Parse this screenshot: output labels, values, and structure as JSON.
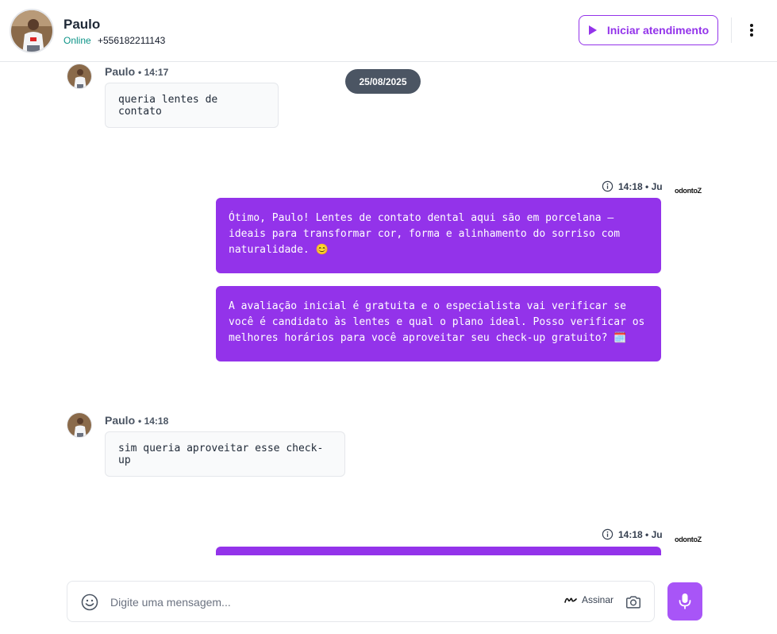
{
  "header": {
    "contact_name": "Paulo",
    "status": "Online",
    "phone": "+556182211143",
    "start_button_label": "Iniciar atendimento"
  },
  "chat": {
    "date_separator": "25/08/2025",
    "messages": [
      {
        "direction": "in",
        "sender": "Paulo",
        "time": "14:17",
        "text": "queria lentes de contato"
      },
      {
        "direction": "out",
        "sender": "Ju",
        "time": "14:18",
        "parts": [
          "Ótimo, Paulo! Lentes de contato dental aqui são em porcelana — ideais para transformar cor, forma e alinhamento do sorriso com naturalidade. 😊",
          "A avaliação inicial é gratuita e o especialista vai verificar se você é candidato às lentes e qual o plano ideal. Posso verificar os melhores horários para você aproveitar seu check-up gratuito? 🗓️"
        ],
        "brand": "odontoZ"
      },
      {
        "direction": "in",
        "sender": "Paulo",
        "time": "14:18",
        "text": "sim queria aproveitar esse check-up"
      },
      {
        "direction": "out",
        "sender": "Ju",
        "time": "14:18",
        "parts": [
          ""
        ],
        "brand": "odontoZ"
      }
    ]
  },
  "composer": {
    "placeholder": "Digite uma mensagem...",
    "sign_label": "Assinar"
  },
  "colors": {
    "accent": "#9333ea",
    "mic_button": "#a855f7",
    "date_pill": "#4b5563",
    "online": "#0d9488"
  },
  "icons": [
    "play-icon",
    "more-vertical-icon",
    "info-icon",
    "emoji-icon",
    "signature-icon",
    "camera-icon",
    "microphone-icon"
  ]
}
